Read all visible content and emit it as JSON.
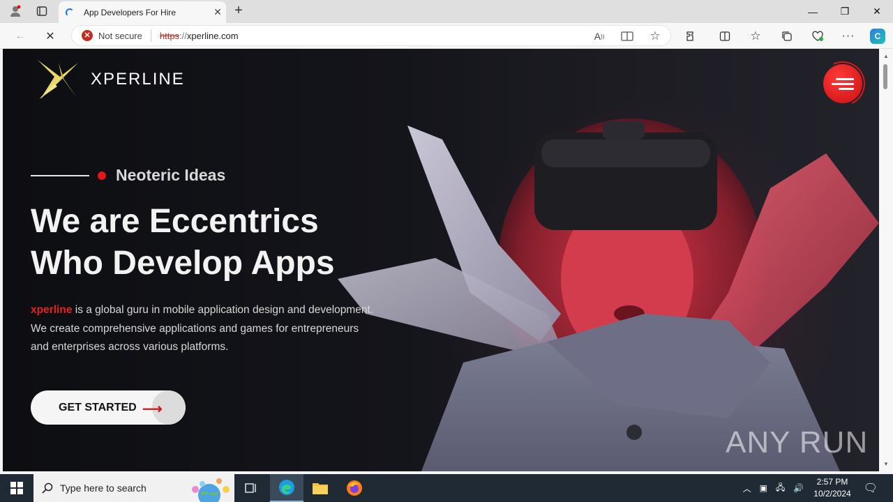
{
  "browser": {
    "tab_title": "App Developers For Hire",
    "security_label": "Not secure",
    "url_scheme": "https",
    "url_sep": "://",
    "url_host": "xperline.com"
  },
  "page": {
    "logo_text": "XPERLINE",
    "tagline": "Neoteric Ideas",
    "headline_line1": "We are Eccentrics",
    "headline_line2": "Who Develop Apps",
    "desc_brand": "xperline",
    "desc_text": " is a global guru in mobile application design and development. We create comprehensive applications and games for entrepreneurs and enterprises across various platforms.",
    "cta_label": "GET STARTED",
    "watermark": "ANY RUN",
    "colors": {
      "accent": "#e01818",
      "background": "#101014"
    }
  },
  "taskbar": {
    "search_placeholder": "Type here to search",
    "time": "2:57 PM",
    "date": "10/2/2024"
  }
}
